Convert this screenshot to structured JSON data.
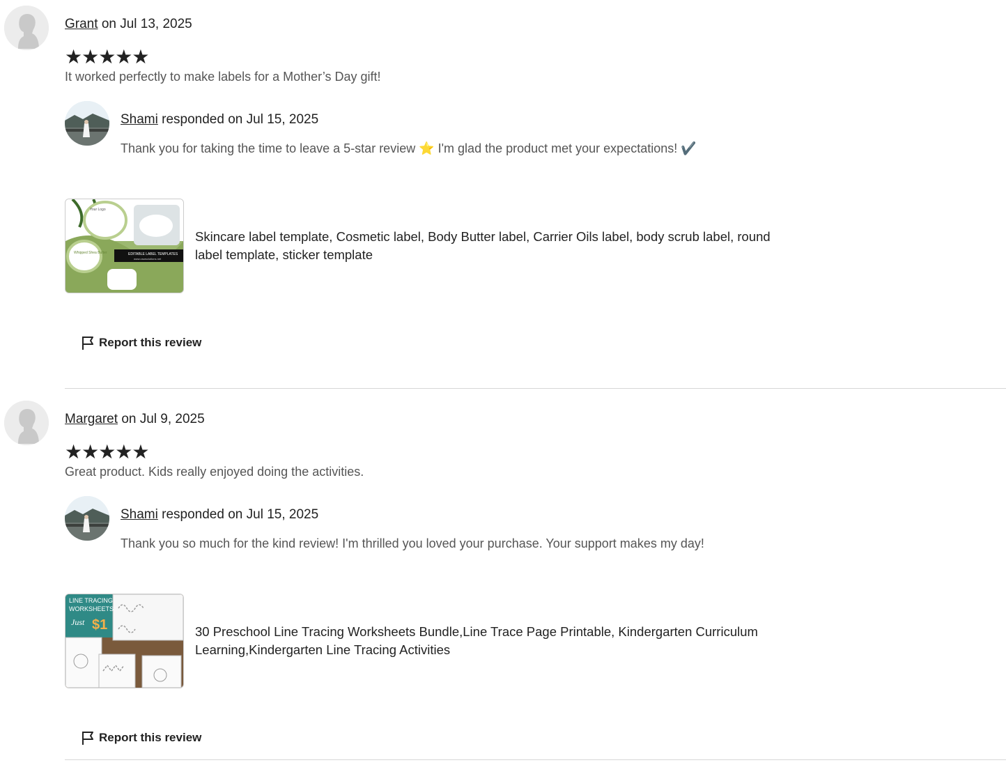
{
  "reviews": [
    {
      "reviewer": "Grant",
      "date_text": "on Jul 13, 2025",
      "stars": "★★★★★",
      "rating": 5,
      "text": "It worked perfectly to make labels for a Mother’s Day gift!",
      "response": {
        "seller": "Shami",
        "date_text": "responded on Jul 15, 2025",
        "text": "Thank you for taking the time to leave a 5-star review ⭐ I'm glad the product met your expectations! ✔️"
      },
      "product": {
        "title": "Skincare label template, Cosmetic label, Body Butter label, Carrier Oils label, body scrub label, round label template, sticker template",
        "thumb_texts": [
          "Your Logo",
          "Whipped Shea Butter",
          "EDITABLE LABEL TEMPLATES",
          "www.oswsolutions.net"
        ]
      },
      "report_label": "Report this review"
    },
    {
      "reviewer": "Margaret",
      "date_text": "on Jul 9, 2025",
      "stars": "★★★★★",
      "rating": 5,
      "text": "Great product. Kids really enjoyed doing the activities.",
      "response": {
        "seller": "Shami",
        "date_text": "responded on Jul 15, 2025",
        "text": "Thank you so much for the kind review! I'm thrilled you loved your purchase. Your support makes my day!"
      },
      "product": {
        "title": "30 Preschool Line Tracing Worksheets Bundle,Line Trace Page Printable, Kindergarten Curriculum Learning,Kindergarten Line Tracing Activities",
        "thumb_texts": [
          "LINE TRACING",
          "WORKSHEETS",
          "Just",
          "$1"
        ]
      },
      "report_label": "Report this review"
    }
  ],
  "colors": {
    "text": "#222222",
    "muted": "#555555",
    "divider": "#d6d6d6",
    "thumb_green": "#8aa85a",
    "thumb_teal": "#2f8a86"
  }
}
